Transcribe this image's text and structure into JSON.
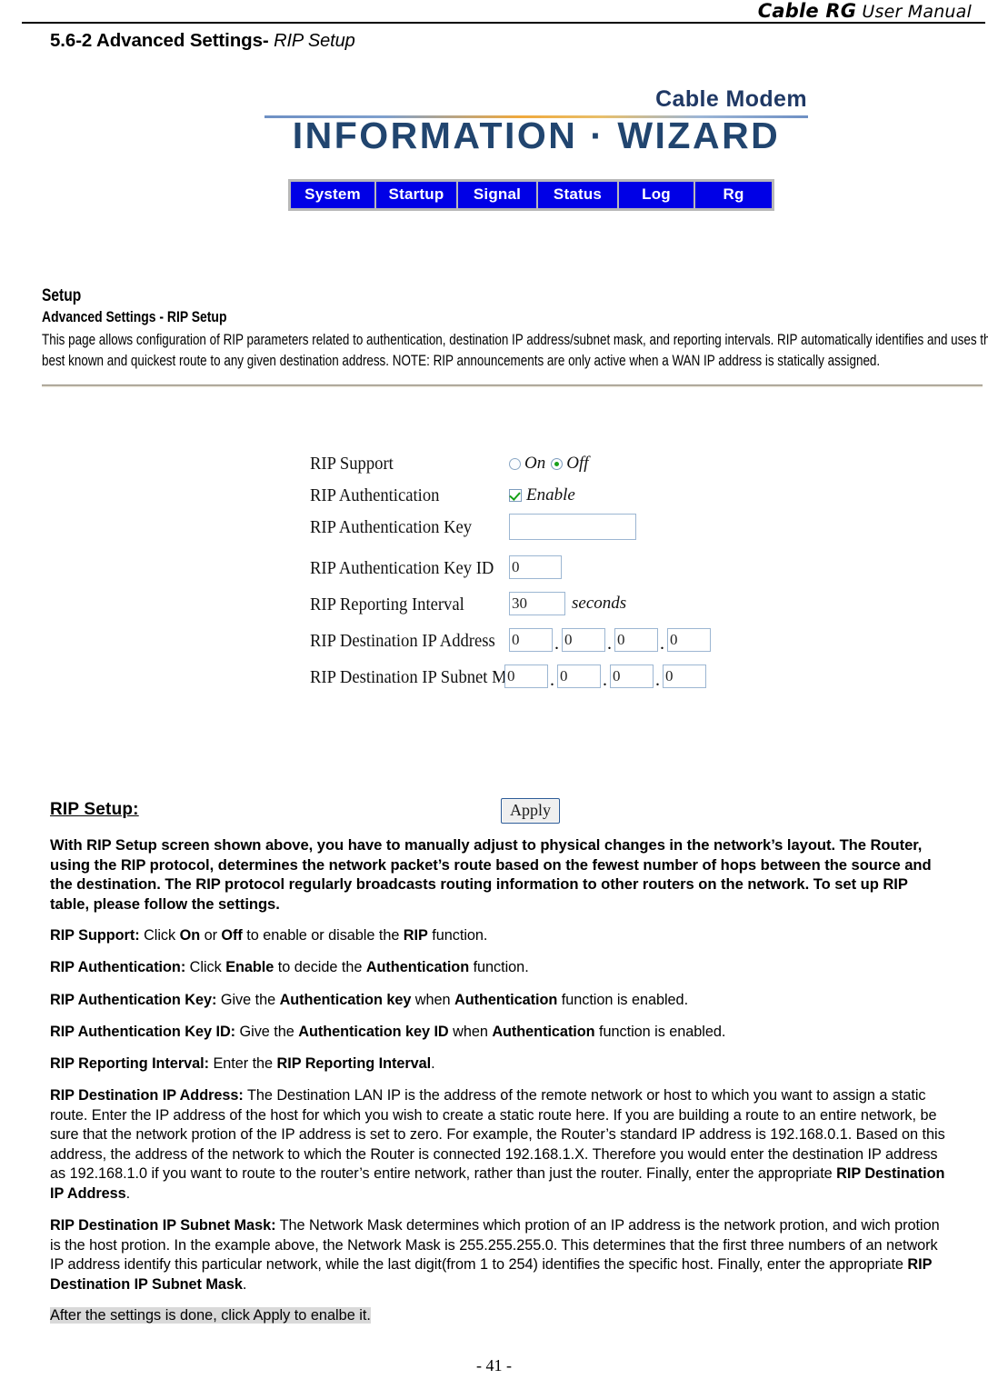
{
  "document": {
    "header_title_italic": "Cable RG",
    "header_title_rest": " User Manual",
    "page_number": "- 41 -"
  },
  "section": {
    "number_and_title": "5.6-2 Advanced Settings-",
    "subtitle_italic": " RIP Setup"
  },
  "device_ui": {
    "brand": {
      "sub": "Cable Modem",
      "main": "INFORMATION  ·  WIZARD"
    },
    "nav_tabs": [
      {
        "label": "System"
      },
      {
        "label": "Startup"
      },
      {
        "label": "Signal"
      },
      {
        "label": "Status"
      },
      {
        "label": "Log"
      },
      {
        "label": "Rg"
      }
    ],
    "setup": {
      "heading": "Setup",
      "subheading": "Advanced Settings - RIP Setup",
      "description": "This page allows configuration of RIP parameters related to authentication, destination IP address/subnet mask, and reporting intervals.  RIP automatically identifies and uses the best known and quickest route to any given destination address. NOTE: RIP announcements are only active when a WAN IP address is statically assigned."
    },
    "form": {
      "rip_support": {
        "label": "RIP Support",
        "option_on": "On",
        "option_off": "Off",
        "selected": "Off"
      },
      "rip_authentication": {
        "label": "RIP Authentication",
        "checkbox_label": "Enable",
        "checked": true
      },
      "rip_authentication_key": {
        "label": "RIP Authentication Key",
        "value": ""
      },
      "rip_authentication_key_id": {
        "label": "RIP Authentication Key ID",
        "value": "0"
      },
      "rip_reporting_interval": {
        "label": "RIP Reporting Interval",
        "value": "30",
        "unit": "seconds"
      },
      "rip_destination_ip": {
        "label": "RIP Destination IP Address",
        "octets": [
          "0",
          "0",
          "0",
          "0"
        ]
      },
      "rip_destination_subnet": {
        "label": "RIP Destination IP Subnet Mask",
        "octets": [
          "0",
          "0",
          "0",
          "0"
        ]
      },
      "apply_label": "Apply"
    }
  },
  "manual": {
    "heading": "RIP Setup:",
    "intro": "With RIP Setup screen shown above, you have to manually adjust to physical changes in the network’s layout. The Router, using the RIP protocol, determines the network packet’s route based on the fewest number of hops between the source and the destination. The RIP protocol regularly broadcasts routing information to other routers on the network. To set up RIP table, please follow the settings.",
    "definitions": [
      {
        "term": "RIP Support:",
        "html": " Click <b>On</b> or <b>Off</b> to enable or disable the <b>RIP</b> function."
      },
      {
        "term": "RIP Authentication:",
        "html": " Click <b>Enable</b> to decide the <b>Authentication</b> function."
      },
      {
        "term": "RIP Authentication Key:",
        "html": " Give the <b>Authentication key</b> when <b>Authentication</b> function is enabled."
      },
      {
        "term": "RIP Authentication Key ID:",
        "html": " Give the <b>Authentication key ID</b> when <b>Authentication</b> function is enabled."
      },
      {
        "term": "RIP Reporting Interval:",
        "html": " Enter the <b>RIP Reporting Interval</b>."
      },
      {
        "term": "RIP Destination IP Address:",
        "html": " The Destination LAN IP is the address of the remote network or host to which you want to assign a static route. Enter the IP address of the host for which you wish to create a static route here. If you are building a route to an entire network, be sure that the network protion of the IP address is set to zero. For example, the Router’s standard IP address is 192.168.0.1. Based on this address, the address of the network to which the Router is connected 192.168.1.X. Therefore you would enter the destination IP address as 192.168.1.0 if you want to route to the router’s entire network, rather than just the router. Finally, enter the appropriate <b>RIP Destination IP Address</b>."
      },
      {
        "term": "RIP Destination IP Subnet Mask:",
        "html": " The Network Mask determines which protion of an IP address is the network protion, and wich protion is the host protion. In the example above, the Network Mask is 255.255.255.0. This determines that the first three numbers of an network IP address identify this particular network, while the last digit(from 1 to 254) identifies the specific host. Finally, enter the appropriate <b>RIP Destination IP Subnet Mask</b>."
      }
    ],
    "final_note": "After the settings is done, click Apply to enalbe it."
  }
}
